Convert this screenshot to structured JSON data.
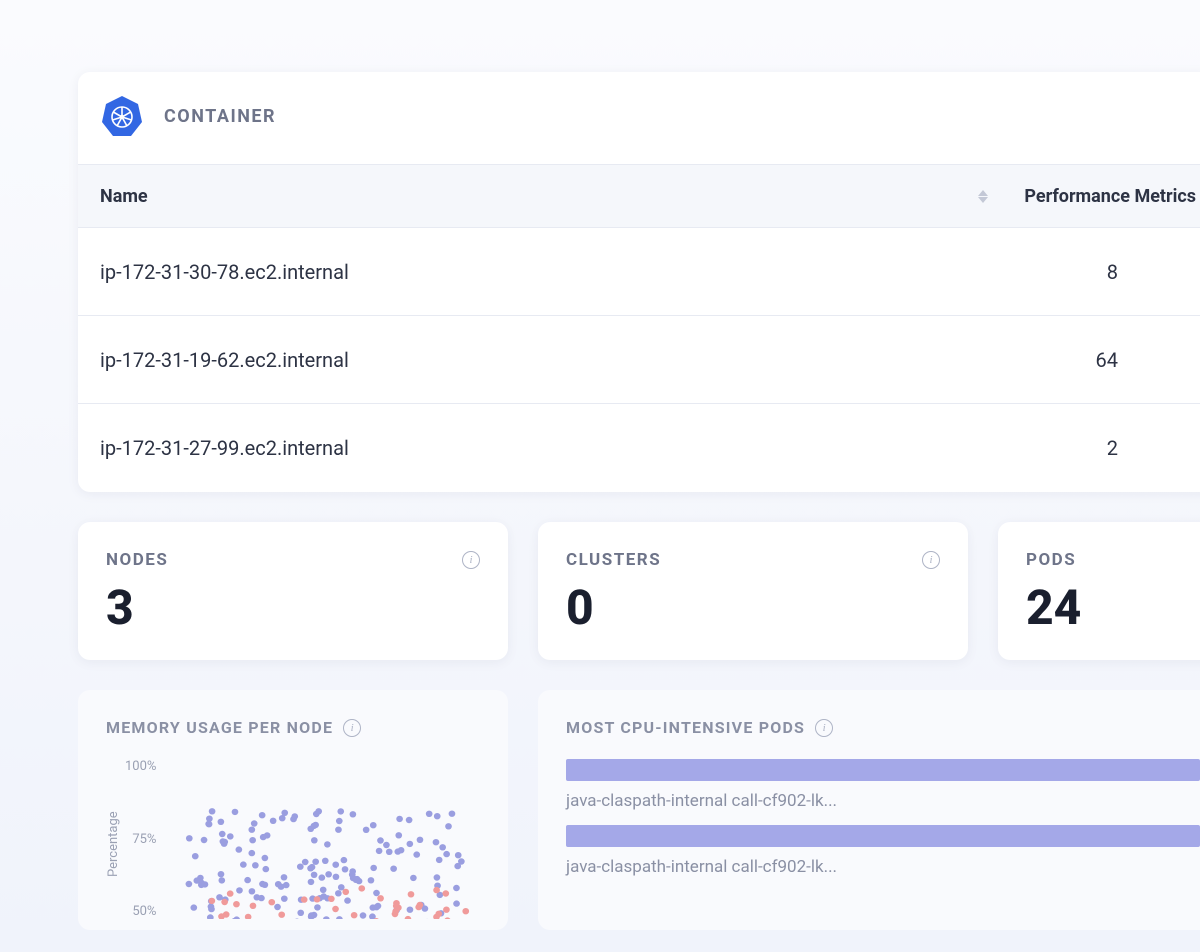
{
  "container": {
    "title": "CONTAINER",
    "table": {
      "columns": {
        "name": "Name",
        "metrics": "Performance Metrics"
      },
      "rows": [
        {
          "name": "ip-172-31-30-78.ec2.internal",
          "metrics": "8"
        },
        {
          "name": "ip-172-31-19-62.ec2.internal",
          "metrics": "64"
        },
        {
          "name": "ip-172-31-27-99.ec2.internal",
          "metrics": "2"
        }
      ]
    }
  },
  "metrics": {
    "nodes": {
      "label": "NODES",
      "value": "3"
    },
    "clusters": {
      "label": "CLUSTERS",
      "value": "0"
    },
    "pods": {
      "label": "PODS",
      "value": "24"
    }
  },
  "charts": {
    "memory": {
      "title": "MEMORY USAGE PER NODE",
      "yAxisLabel": "Percentage",
      "ticks": {
        "t100": "100%",
        "t75": "75%",
        "t50": "50%"
      }
    },
    "cpu": {
      "title": "MOST CPU-INTENSIVE PODS",
      "items": [
        {
          "label": "java-claspath-internal call-cf902-lk..."
        },
        {
          "label": "java-claspath-internal call-cf902-lk..."
        }
      ]
    }
  },
  "chart_data": [
    {
      "type": "scatter",
      "title": "MEMORY USAGE PER NODE",
      "ylabel": "Percentage",
      "ylim": [
        0,
        100
      ],
      "yticks": [
        50,
        75,
        100
      ],
      "note": "dense scatter, ~150 purple points 45-85%, ~50 red points 40-60%, x-axis unlabeled"
    },
    {
      "type": "bar",
      "title": "MOST CPU-INTENSIVE PODS",
      "orientation": "horizontal",
      "categories": [
        "java-claspath-internal call-cf902-lk...",
        "java-claspath-internal call-cf902-lk..."
      ],
      "values": [
        100,
        100
      ],
      "note": "bars appear full-width; actual values truncated/off-screen"
    }
  ]
}
